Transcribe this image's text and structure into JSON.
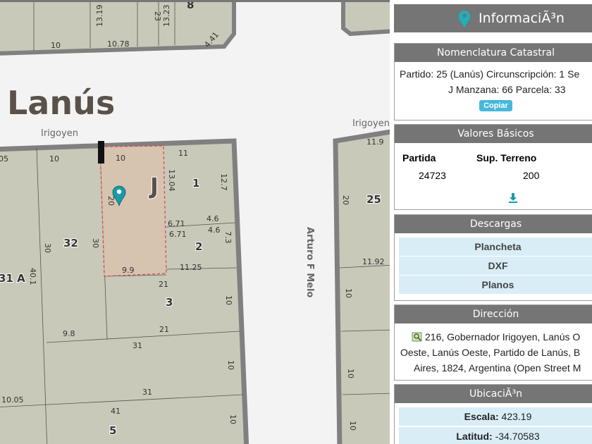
{
  "map": {
    "locality_label": "Lanús",
    "streets": [
      "Irigoyen",
      "Irigoyen",
      "Arturo F Melo"
    ],
    "block_letter": "J",
    "parcel_numbers": [
      "8",
      "1",
      "2",
      "3",
      "32",
      "31 A",
      "5",
      "25"
    ],
    "dims": [
      "13.19",
      "23",
      "13.23",
      "10",
      "10.78",
      "4.41",
      "05",
      "10",
      "10",
      "11",
      "13.04",
      "12.7",
      "20",
      "6.71",
      "4.6",
      "6.71",
      "4.6",
      "7.3",
      "30",
      "30",
      "40.1",
      "9.9",
      "11.25",
      "21",
      "10",
      "21",
      "9.8",
      "31",
      "10",
      "31",
      "10.05",
      "41",
      "10",
      "11.9",
      "20",
      "11.92",
      "10",
      "10",
      "10"
    ]
  },
  "panel": {
    "title": "InformaciÃ³n",
    "nomenclatura": {
      "heading": "Nomenclatura Catastral",
      "line1": "Partido: 25 (Lanús) Circunscripción: 1 Se",
      "line2": "J Manzana: 66 Parcela: 33",
      "copy_button": "Copiar"
    },
    "valores": {
      "heading": "Valores Básicos",
      "col_partida": "Partida",
      "col_sup": "Sup. Terreno",
      "partida": "24723",
      "sup": "200"
    },
    "descargas": {
      "heading": "Descargas",
      "items": [
        "Plancheta",
        "DXF",
        "Planos"
      ]
    },
    "direccion": {
      "heading": "Dirección",
      "line1": "216, Gobernador Irigoyen, Lanús O",
      "line2": "Oeste, Lanús Oeste, Partido de Lanús, B",
      "line3": "Aires, 1824, Argentina (Open Street M"
    },
    "ubicacion": {
      "heading": "UbicaciÃ³n",
      "escala_label": "Escala:",
      "escala_value": "423.19",
      "latitud_label": "Latitud:",
      "latitud_value": "-34.70583"
    }
  },
  "colors": {
    "parcel_fill": "#c8c9b8",
    "road": "#f3f3f3",
    "border": "#7a7a7a",
    "selected": "#d8c3b0",
    "accent": "#1a9aa8"
  }
}
